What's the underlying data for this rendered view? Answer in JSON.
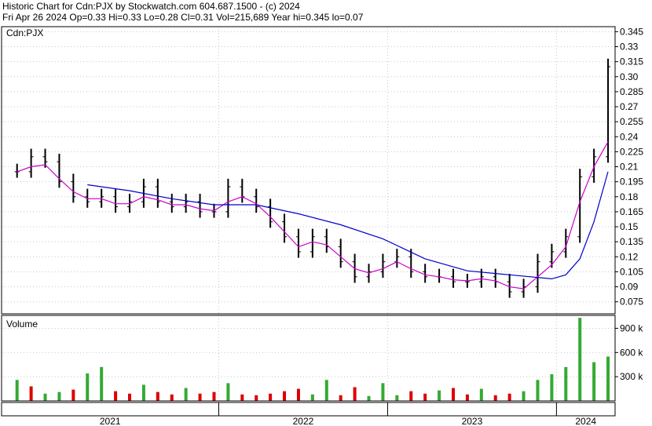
{
  "header": {
    "line1": "Historic Chart for Cdn:PJX by Stockwatch.com 604.687.1500 - (c) 2024",
    "line2": "Fri Apr 26 2024   Op=0.33   Hi=0.33   Lo=0.28   Cl=0.31   Vol=215,689   Year hi=0.345   lo=0.07"
  },
  "colors": {
    "price_bar": "#000000",
    "ma_short": "#cc00cc",
    "ma_long": "#0000cc",
    "volume_up": "#33aa33",
    "volume_down": "#dd0000",
    "volume_flat": "#999999",
    "grid": "#c8c8c8",
    "frame": "#000000"
  },
  "chart_data": [
    {
      "type": "line",
      "panel": "price",
      "title": "Cdn:PJX",
      "y_ticks": [
        "0.345",
        "0.33",
        "0.315",
        "0.30",
        "0.285",
        "0.27",
        "0.255",
        "0.24",
        "0.225",
        "0.21",
        "0.195",
        "0.18",
        "0.165",
        "0.15",
        "0.135",
        "0.12",
        "0.105",
        "0.09",
        "0.075"
      ],
      "ylim": [
        0.063,
        0.35
      ],
      "x_labels": [
        "2021",
        "2022",
        "2023",
        "2024"
      ],
      "grid": true,
      "series": [
        {
          "style": "bars",
          "x": [
            "2020-10",
            "2020-11",
            "2020-12",
            "2021-01",
            "2021-02",
            "2021-03",
            "2021-04",
            "2021-05",
            "2021-06",
            "2021-07",
            "2021-08",
            "2021-09",
            "2021-10",
            "2021-11",
            "2021-12",
            "2022-01",
            "2022-02",
            "2022-03",
            "2022-04",
            "2022-05",
            "2022-06",
            "2022-07",
            "2022-08",
            "2022-09",
            "2022-10",
            "2022-11",
            "2022-12",
            "2023-01",
            "2023-02",
            "2023-03",
            "2023-04",
            "2023-05",
            "2023-06",
            "2023-07",
            "2023-08",
            "2023-09",
            "2023-10",
            "2023-11",
            "2023-12",
            "2024-01",
            "2024-02",
            "2024-03",
            "2024-04"
          ],
          "values": [
            0.205,
            0.22,
            0.215,
            0.195,
            0.18,
            0.175,
            0.18,
            0.17,
            0.175,
            0.19,
            0.175,
            0.17,
            0.175,
            0.165,
            0.165,
            0.19,
            0.18,
            0.17,
            0.155,
            0.14,
            0.125,
            0.14,
            0.13,
            0.115,
            0.1,
            0.105,
            0.115,
            0.12,
            0.105,
            0.1,
            0.1,
            0.095,
            0.095,
            0.1,
            0.095,
            0.085,
            0.09,
            0.115,
            0.125,
            0.14,
            0.2,
            0.22,
            0.31
          ]
        },
        {
          "style": "line",
          "x": [
            "2020-10",
            "2020-11",
            "2020-12",
            "2021-01",
            "2021-02",
            "2021-03",
            "2021-04",
            "2021-05",
            "2021-06",
            "2021-07",
            "2021-08",
            "2021-09",
            "2021-10",
            "2021-11",
            "2021-12",
            "2022-01",
            "2022-02",
            "2022-03",
            "2022-04",
            "2022-05",
            "2022-06",
            "2022-07",
            "2022-08",
            "2022-09",
            "2022-10",
            "2022-11",
            "2022-12",
            "2023-01",
            "2023-02",
            "2023-03",
            "2023-04",
            "2023-05",
            "2023-06",
            "2023-07",
            "2023-08",
            "2023-09",
            "2023-10",
            "2023-11",
            "2023-12",
            "2024-01",
            "2024-02",
            "2024-03",
            "2024-04"
          ],
          "values": [
            0.205,
            0.21,
            0.212,
            0.198,
            0.185,
            0.178,
            0.178,
            0.173,
            0.173,
            0.18,
            0.177,
            0.172,
            0.172,
            0.168,
            0.166,
            0.175,
            0.18,
            0.173,
            0.16,
            0.145,
            0.13,
            0.135,
            0.132,
            0.12,
            0.108,
            0.104,
            0.108,
            0.115,
            0.108,
            0.102,
            0.1,
            0.097,
            0.096,
            0.098,
            0.096,
            0.09,
            0.088,
            0.1,
            0.112,
            0.13,
            0.175,
            0.21,
            0.235
          ]
        },
        {
          "style": "line",
          "x": [
            "2021-03",
            "2021-06",
            "2021-09",
            "2021-12",
            "2022-03",
            "2022-06",
            "2022-09",
            "2022-12",
            "2023-03",
            "2023-06",
            "2023-09",
            "2023-12",
            "2024-01",
            "2024-02",
            "2024-03",
            "2024-04"
          ],
          "values": [
            0.192,
            0.186,
            0.178,
            0.172,
            0.172,
            0.163,
            0.152,
            0.138,
            0.118,
            0.106,
            0.102,
            0.098,
            0.102,
            0.118,
            0.155,
            0.205
          ]
        }
      ]
    },
    {
      "type": "bar",
      "panel": "volume",
      "title": "Volume",
      "y_ticks": [
        "900 k",
        "600 k",
        "300 k"
      ],
      "ylim": [
        0,
        1060000
      ],
      "x": [
        "2020-10",
        "2020-11",
        "2020-12",
        "2021-01",
        "2021-02",
        "2021-03",
        "2021-04",
        "2021-05",
        "2021-06",
        "2021-07",
        "2021-08",
        "2021-09",
        "2021-10",
        "2021-11",
        "2021-12",
        "2022-01",
        "2022-02",
        "2022-03",
        "2022-04",
        "2022-05",
        "2022-06",
        "2022-07",
        "2022-08",
        "2022-09",
        "2022-10",
        "2022-11",
        "2022-12",
        "2023-01",
        "2023-02",
        "2023-03",
        "2023-04",
        "2023-05",
        "2023-06",
        "2023-07",
        "2023-08",
        "2023-09",
        "2023-10",
        "2023-11",
        "2023-12",
        "2024-01",
        "2024-02",
        "2024-03",
        "2024-04"
      ],
      "values": [
        260000,
        180000,
        90000,
        110000,
        140000,
        340000,
        420000,
        120000,
        90000,
        200000,
        110000,
        80000,
        160000,
        90000,
        110000,
        220000,
        80000,
        70000,
        90000,
        120000,
        150000,
        80000,
        260000,
        70000,
        170000,
        60000,
        220000,
        70000,
        120000,
        90000,
        130000,
        160000,
        80000,
        150000,
        70000,
        90000,
        120000,
        260000,
        330000,
        420000,
        1030000,
        480000,
        550000
      ],
      "direction": [
        "up",
        "down",
        "up",
        "up",
        "down",
        "up",
        "up",
        "down",
        "down",
        "up",
        "down",
        "down",
        "up",
        "down",
        "down",
        "up",
        "down",
        "down",
        "down",
        "down",
        "down",
        "up",
        "up",
        "down",
        "down",
        "up",
        "up",
        "up",
        "down",
        "down",
        "up",
        "down",
        "down",
        "up",
        "down",
        "down",
        "up",
        "up",
        "up",
        "up",
        "up",
        "up",
        "up"
      ]
    }
  ]
}
